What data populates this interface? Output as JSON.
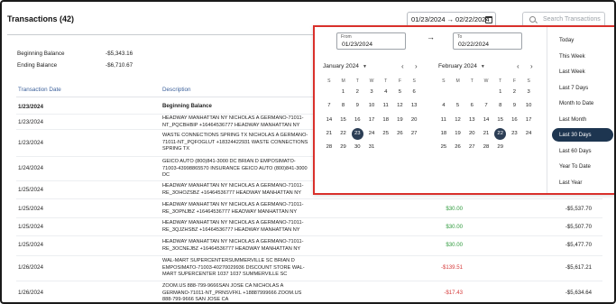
{
  "header": {
    "title": "Transactions (42)",
    "date_range_start": "01/23/2024",
    "date_range_arrow": "→",
    "date_range_end": "02/22/2024",
    "search_placeholder": "Search Transactions"
  },
  "balances": {
    "beginning_label": "Beginning Balance",
    "beginning_value": "-$5,343.16",
    "ending_label": "Ending Balance",
    "ending_value": "-$6,710.67"
  },
  "table": {
    "columns": [
      "Transaction Date",
      "Description"
    ],
    "rows": [
      {
        "date": "1/23/2024",
        "desc": "Beginning Balance",
        "amount": "",
        "amount_type": "",
        "balance": "",
        "bold": true
      },
      {
        "date": "1/23/2024",
        "desc": "HEADWAY MANHATTAN NY NICHOLAS A GERMANO-71011-NT_PQCBHBIP +16464536777 HEADWAY MANHATTAN NY",
        "amount": "",
        "amount_type": "",
        "balance": ""
      },
      {
        "date": "1/23/2024",
        "desc": "WASTE CONNECTIONS SPRING TX NICHOLAS A GERMANO-71011-NT_PQFOGLUT +18324422931 WASTE CONNECTIONS SPRING TX",
        "amount": "",
        "amount_type": "",
        "balance": ""
      },
      {
        "date": "1/24/2024",
        "desc": "GEICO AUTO (800)841-3000 DC BRIAN D EMPOSIMATO-71003-43998865570 INSURANCE GEICO AUTO (800)841-3000 DC",
        "amount": "",
        "amount_type": "",
        "balance": ""
      },
      {
        "date": "1/25/2024",
        "desc": "HEADWAY MANHATTAN NY NICHOLAS A GERMANO-71011-RE_3OHOZSBZ +16464536777 HEADWAY MANHATTAN NY",
        "amount": "",
        "amount_type": "",
        "balance": ""
      },
      {
        "date": "1/25/2024",
        "desc": "HEADWAY MANHATTAN NY NICHOLAS A GERMANO-71011-RE_3OPNJBZ +16464536777 HEADWAY MANHATTAN NY",
        "amount": "$30.00",
        "amount_type": "pos",
        "balance": "-$5,537.70"
      },
      {
        "date": "1/25/2024",
        "desc": "HEADWAY MANHATTAN NY NICHOLAS A GERMANO-71011-RE_3QJZHSBZ +16464536777 HEADWAY MANHATTAN NY",
        "amount": "$30.00",
        "amount_type": "pos",
        "balance": "-$5,507.70"
      },
      {
        "date": "1/25/2024",
        "desc": "HEADWAY MANHATTAN NY NICHOLAS A GERMANO-71011-RE_3OCNEJBZ +16464536777 HEADWAY MANHATTAN NY",
        "amount": "$30.00",
        "amount_type": "pos",
        "balance": "-$5,477.70"
      },
      {
        "date": "1/26/2024",
        "desc": "WAL-MART SUPERCENTERSUMMERVILLE SC BRIAN D EMPOSIMATO-71003-40270029936 DISCOUNT STORE WAL-MART SUPERCENTER 1037 1037 SUMMERVILLE SC",
        "amount": "-$139.51",
        "amount_type": "neg",
        "balance": "-$5,617.21"
      },
      {
        "date": "1/26/2024",
        "desc": "ZOOM.US 888-799-9666SAN JOSE CA NICHOLAS A GERMANO-71011-NT_PRNSVFKL +18887999666 ZOOM.US 888-799-9666 SAN JOSE CA",
        "amount": "-$17.43",
        "amount_type": "neg",
        "balance": "-$5,634.64"
      }
    ]
  },
  "picker": {
    "from_label": "From",
    "from_value": "01/23/2024",
    "arrow": "→",
    "to_label": "To",
    "to_value": "02/22/2024",
    "prev": "‹",
    "next": "›",
    "dows": [
      "S",
      "M",
      "T",
      "W",
      "T",
      "F",
      "S"
    ],
    "months": [
      {
        "name": "January 2024",
        "weeks": [
          [
            "",
            "1",
            "2",
            "3",
            "4",
            "5",
            "6"
          ],
          [
            "7",
            "8",
            "9",
            "10",
            "11",
            "12",
            "13"
          ],
          [
            "14",
            "15",
            "16",
            "17",
            "18",
            "19",
            "20"
          ],
          [
            "21",
            "22",
            "23",
            "24",
            "25",
            "26",
            "27"
          ],
          [
            "28",
            "29",
            "30",
            "31",
            "",
            "",
            ""
          ]
        ],
        "selected": "23"
      },
      {
        "name": "February 2024",
        "weeks": [
          [
            "",
            "",
            "",
            "",
            "1",
            "2",
            "3"
          ],
          [
            "4",
            "5",
            "6",
            "7",
            "8",
            "9",
            "10"
          ],
          [
            "11",
            "12",
            "13",
            "14",
            "15",
            "16",
            "17"
          ],
          [
            "18",
            "19",
            "20",
            "21",
            "22",
            "23",
            "24"
          ],
          [
            "25",
            "26",
            "27",
            "28",
            "29",
            "",
            ""
          ]
        ],
        "selected": "22"
      }
    ],
    "presets": [
      "Today",
      "This Week",
      "Last Week",
      "Last 7 Days",
      "Month to Date",
      "Last Month",
      "Last 30 Days",
      "Last 60 Days",
      "Year To Date",
      "Last Year"
    ],
    "active_preset": "Last 30 Days"
  }
}
